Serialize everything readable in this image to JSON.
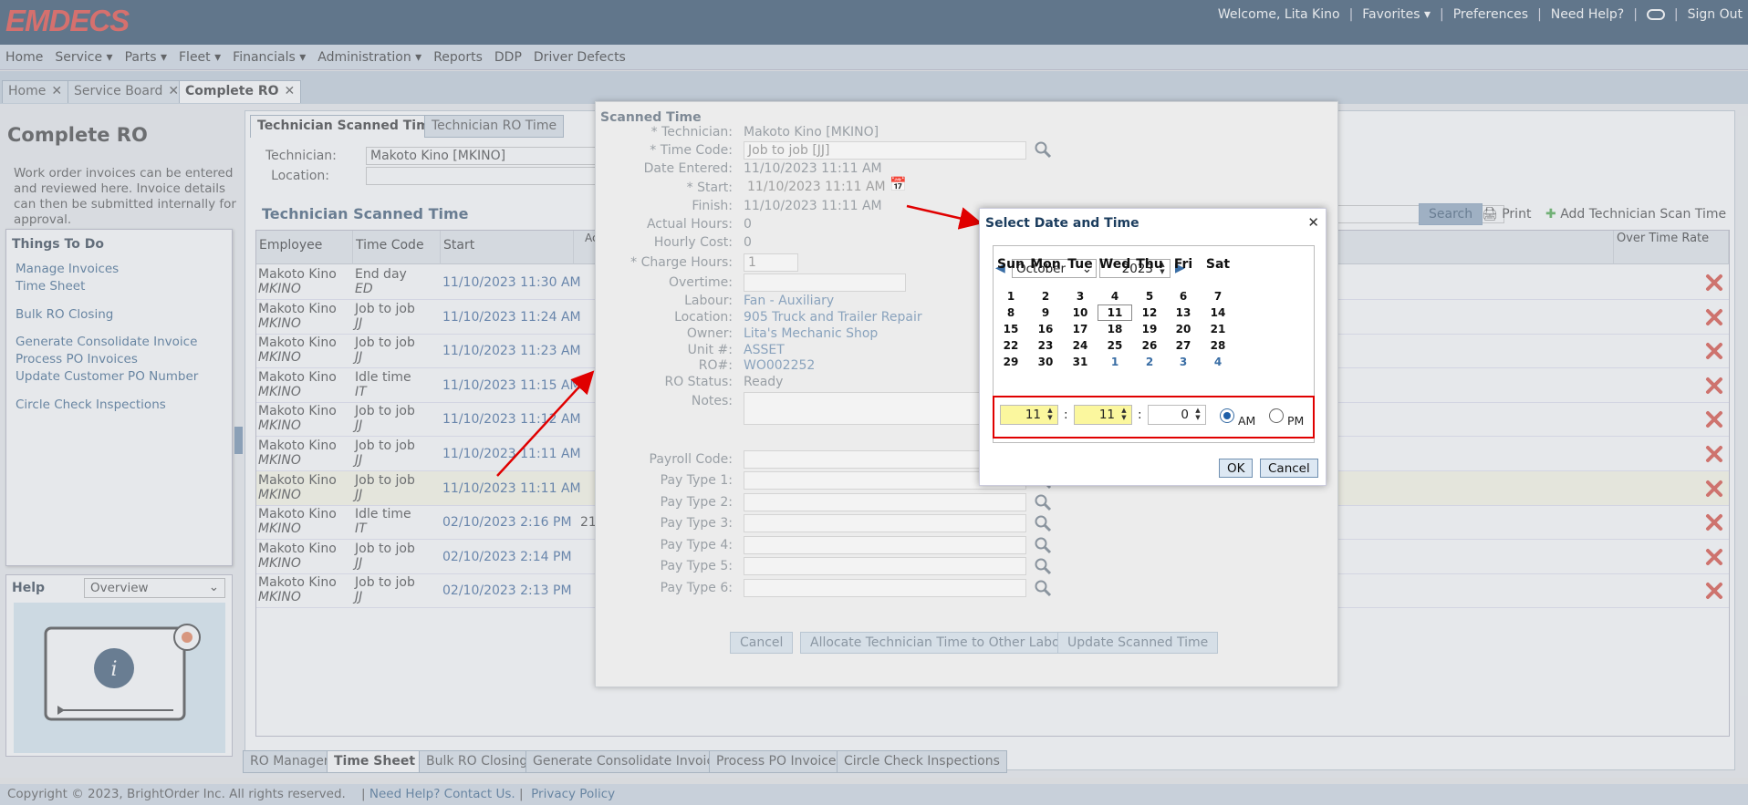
{
  "topbar": {
    "logo": "EMDECS",
    "welcome": "Welcome, Lita Kino",
    "favorites": "Favorites",
    "preferences": "Preferences",
    "need_help": "Need Help?",
    "sign_out": "Sign Out"
  },
  "nav": [
    "Home",
    "Service",
    "Parts",
    "Fleet",
    "Financials",
    "Administration",
    "Reports",
    "DDP",
    "Driver Defects"
  ],
  "tabs": [
    "Home",
    "Service Board",
    "Complete RO"
  ],
  "left": {
    "title": "Complete RO",
    "desc": "Work order invoices can be entered and reviewed here. Invoice details can then be submitted internally for approval.",
    "todo_title": "Things To Do",
    "todo": [
      "Manage Invoices",
      "Time Sheet",
      "Bulk RO Closing",
      "Generate Consolidate Invoice",
      "Process PO Invoices",
      "Update Customer PO Number",
      "Circle Check Inspections"
    ],
    "help_title": "Help",
    "help_select": "Overview"
  },
  "content": {
    "tabs": [
      "Technician Scanned Time",
      "Technician RO Time"
    ],
    "technician_label": "Technician:",
    "technician_value": "Makoto Kino [MKINO]",
    "location_label": "Location:",
    "heading": "Technician Scanned Time",
    "search": "Search",
    "print": "Print",
    "add": "Add Technician Scan Time",
    "cols": [
      "Employee",
      "Time Code",
      "Start",
      "Ac H",
      "Over Time Rate"
    ]
  },
  "rows": [
    {
      "name": "Makoto Kino",
      "id": "MKINO",
      "code": "End day",
      "abbr": "ED",
      "start": "11/10/2023 11:30 AM",
      "hrs": ""
    },
    {
      "name": "Makoto Kino",
      "id": "MKINO",
      "code": "Job to job",
      "abbr": "JJ",
      "start": "11/10/2023 11:24 AM",
      "hrs": ""
    },
    {
      "name": "Makoto Kino",
      "id": "MKINO",
      "code": "Job to job",
      "abbr": "JJ",
      "start": "11/10/2023 11:23 AM",
      "hrs": ""
    },
    {
      "name": "Makoto Kino",
      "id": "MKINO",
      "code": "Idle time",
      "abbr": "IT",
      "start": "11/10/2023 11:15 AM",
      "hrs": ""
    },
    {
      "name": "Makoto Kino",
      "id": "MKINO",
      "code": "Job to job",
      "abbr": "JJ",
      "start": "11/10/2023 11:12 AM",
      "hrs": ""
    },
    {
      "name": "Makoto Kino",
      "id": "MKINO",
      "code": "Job to job",
      "abbr": "JJ",
      "start": "11/10/2023 11:11 AM",
      "hrs": ""
    },
    {
      "name": "Makoto Kino",
      "id": "MKINO",
      "code": "Job to job",
      "abbr": "JJ",
      "start": "11/10/2023 11:11 AM",
      "hrs": ""
    },
    {
      "name": "Makoto Kino",
      "id": "MKINO",
      "code": "Idle time",
      "abbr": "IT",
      "start": "02/10/2023 2:16 PM",
      "hrs": "21"
    },
    {
      "name": "Makoto Kino",
      "id": "MKINO",
      "code": "Job to job",
      "abbr": "JJ",
      "start": "02/10/2023 2:14 PM",
      "hrs": ""
    },
    {
      "name": "Makoto Kino",
      "id": "MKINO",
      "code": "Job to job",
      "abbr": "JJ",
      "start": "02/10/2023 2:13 PM",
      "hrs": ""
    }
  ],
  "bottom_tabs": [
    "RO Manager",
    "Time Sheet",
    "Bulk RO Closing",
    "Generate Consolidate Invoice",
    "Process PO Invoices",
    "Circle Check Inspections"
  ],
  "footer": {
    "copyright": "Copyright © 2023, BrightOrder Inc. All rights reserved.",
    "help": "Need Help? Contact Us.",
    "privacy": "Privacy Policy"
  },
  "dialog": {
    "title": "Scanned Time",
    "fields": [
      {
        "label": "* Technician:",
        "value": "Makoto Kino [MKINO]"
      },
      {
        "label": "* Time Code:",
        "value": "Job to job [JJ]"
      },
      {
        "label": "Date Entered:",
        "value": "11/10/2023 11:11 AM"
      },
      {
        "label": "* Start:",
        "value": "11/10/2023 11:11 AM"
      },
      {
        "label": "Finish:",
        "value": "11/10/2023 11:11 AM"
      },
      {
        "label": "Actual Hours:",
        "value": "0"
      },
      {
        "label": "Hourly Cost:",
        "value": "0"
      },
      {
        "label": "* Charge Hours:",
        "value": "1"
      },
      {
        "label": "Overtime:",
        "value": ""
      },
      {
        "label": "Labour:",
        "value": "Fan - Auxiliary"
      },
      {
        "label": "Location:",
        "value": "905 Truck and Trailer Repair"
      },
      {
        "label": "Owner:",
        "value": "Lita's Mechanic Shop"
      },
      {
        "label": "Unit #:",
        "value": "ASSET"
      },
      {
        "label": "RO#:",
        "value": "WO002252"
      },
      {
        "label": "RO Status:",
        "value": "Ready"
      },
      {
        "label": "Notes:",
        "value": ""
      }
    ],
    "payroll": "Payroll Code:",
    "paytypes": [
      "Pay Type 1:",
      "Pay Type 2:",
      "Pay Type 3:",
      "Pay Type 4:",
      "Pay Type 5:",
      "Pay Type 6:"
    ],
    "buttons": [
      "Cancel",
      "Allocate Technician Time to Other Labour",
      "Update Scanned Time"
    ]
  },
  "picker": {
    "title": "Select Date and Time",
    "month": "October",
    "year": "2023",
    "days": [
      "Sun",
      "Mon",
      "Tue",
      "Wed",
      "Thu",
      "Fri",
      "Sat"
    ],
    "weeks": [
      [
        "1",
        "2",
        "3",
        "4",
        "5",
        "6",
        "7"
      ],
      [
        "8",
        "9",
        "10",
        "11",
        "12",
        "13",
        "14"
      ],
      [
        "15",
        "16",
        "17",
        "18",
        "19",
        "20",
        "21"
      ],
      [
        "22",
        "23",
        "24",
        "25",
        "26",
        "27",
        "28"
      ],
      [
        "29",
        "30",
        "31",
        "1",
        "2",
        "3",
        "4"
      ]
    ],
    "selected": "11",
    "hour": "11",
    "minute": "11",
    "second": "0",
    "am": "AM",
    "pm": "PM",
    "ok": "OK",
    "cancel": "Cancel"
  }
}
